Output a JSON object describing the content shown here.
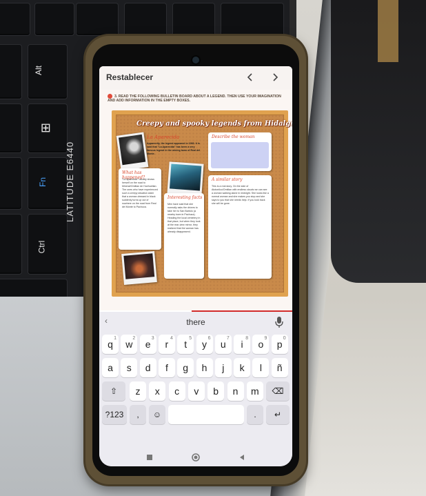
{
  "laptop": {
    "keys": [
      "Alt",
      "Fn",
      "Ctrl"
    ],
    "model": "LATITUDE E6440"
  },
  "viewer": {
    "reset_label": "Restablecer",
    "prev_icon": "chevron-left-icon",
    "next_icon": "chevron-right-icon"
  },
  "document": {
    "instruction": "3. READ THE FOLLOWING BULLETIN BOARD ABOUT A LEGEND. THEN USE YOUR IMAGINATION AND ADD INFORMATION IN THE EMPTY BOXES.",
    "board_title": "Creepy and spooky legends from Hidalgo",
    "card_la_aparecida": {
      "heading": "La Aparecida",
      "text": "Apparently, the legend appeared in 1983. It is said that \"La Aparecida\" has been a very famous legend in the mining town of Real del Monte."
    },
    "card_describe": {
      "heading": "Describe the woman"
    },
    "card_what_happened": {
      "heading": "What has happened?",
      "text": "\"La Aparecida\" usually shows herself on the road to Mineral/Omitlan de Huehuetlan. The ones who have experienced such a creepy situation claim that a woman dressed in black suddenly turns up out of nowhere on the road from Real del Monte to Pachuca."
    },
    "card_interesting": {
      "heading": "Interesting facts",
      "text": "Men have said that she normally asks the drivers to take her to San Bartolo (a nearby town in Pachuca). Heading the local cemetery in that place, but when they look at the rear-view mirror, they realized that the woman has already disappeared."
    },
    "card_similar": {
      "heading": "A similar story",
      "text": "This is a real story. On the side of Atotonilco/Omitlan with endless clouds we can see a woman walking alone in midnight. She looks like a normal woman and she makes you stop and she says to you that she needs help. If you look back she will be gone."
    }
  },
  "keyboard": {
    "suggestion": "there",
    "row1": [
      {
        "k": "q",
        "n": "1"
      },
      {
        "k": "w",
        "n": "2"
      },
      {
        "k": "e",
        "n": "3"
      },
      {
        "k": "r",
        "n": "4"
      },
      {
        "k": "t",
        "n": "5"
      },
      {
        "k": "y",
        "n": "6"
      },
      {
        "k": "u",
        "n": "7"
      },
      {
        "k": "i",
        "n": "8"
      },
      {
        "k": "o",
        "n": "9"
      },
      {
        "k": "p",
        "n": "0"
      }
    ],
    "row2": [
      "a",
      "s",
      "d",
      "f",
      "g",
      "h",
      "j",
      "k",
      "l",
      "ñ"
    ],
    "row3": [
      "z",
      "x",
      "c",
      "v",
      "b",
      "n",
      "m"
    ],
    "symbols_label": "?123",
    "comma_label": ",",
    "period_label": ".",
    "icons": {
      "shift": "shift-icon",
      "backspace": "backspace-icon",
      "emoji": "emoji-icon",
      "enter": "enter-icon",
      "mic": "microphone-icon",
      "expand": "chevron-left-icon"
    }
  },
  "navbar": {
    "icons": [
      "recents-icon",
      "home-icon",
      "back-icon"
    ]
  },
  "colors": {
    "phone_case": "#5e5036",
    "board_cork": "#c98a4a",
    "board_frame": "#e0a24f",
    "accent_red": "#d9452b",
    "blue_box": "#cdd2f4",
    "keyboard_bg": "#ecebf1"
  }
}
